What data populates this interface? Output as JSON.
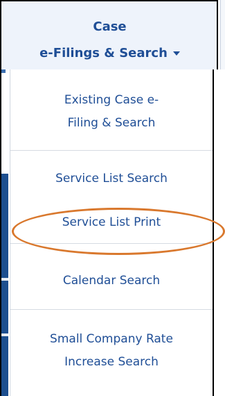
{
  "menu": {
    "title_line1": "Case",
    "title_line2": "e-Filings & Search",
    "items": [
      {
        "line1": "Existing Case e-",
        "line2": "Filing & Search"
      },
      {
        "label": "Service List Search"
      },
      {
        "label": "Service List Print"
      },
      {
        "label": "Calendar Search"
      },
      {
        "line1": "Small Company Rate",
        "line2": "Increase Search"
      }
    ]
  },
  "colors": {
    "link_blue": "#1f4e96",
    "header_bg": "#eef3fb",
    "highlight_ellipse": "#d9782d"
  },
  "icons": {
    "dropdown": "chevron-down-icon"
  }
}
